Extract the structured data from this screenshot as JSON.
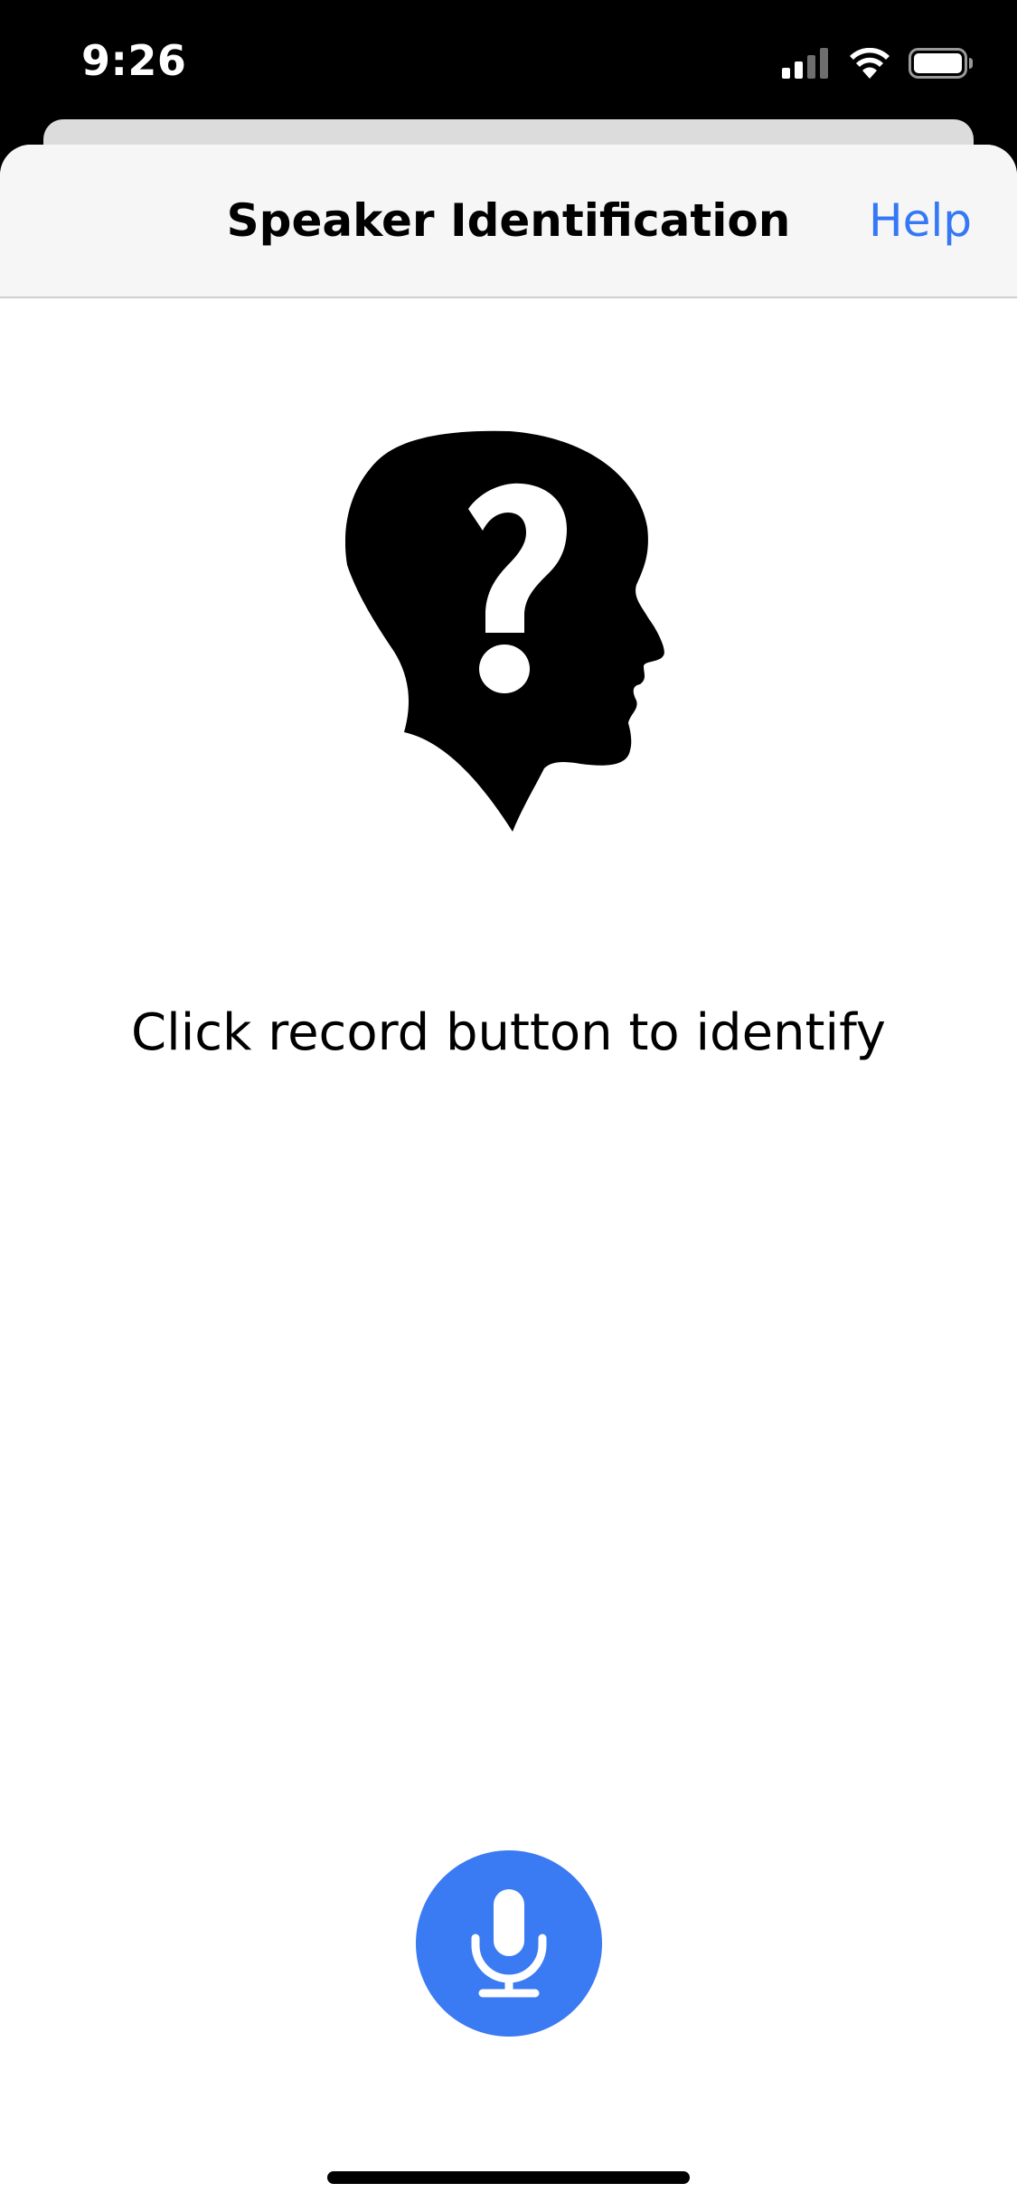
{
  "status_bar": {
    "time": "9:26",
    "icons": [
      "cellular-signal-icon",
      "wifi-icon",
      "battery-icon"
    ]
  },
  "nav": {
    "title": "Speaker Identification",
    "help_label": "Help"
  },
  "main": {
    "illustration": "unknown-speaker-head-icon",
    "prompt": "Click record button to identify"
  },
  "record": {
    "icon": "microphone-icon"
  },
  "colors": {
    "accent": "#3478f6",
    "record_button": "#3a7af2",
    "nav_background": "#f6f6f6"
  }
}
